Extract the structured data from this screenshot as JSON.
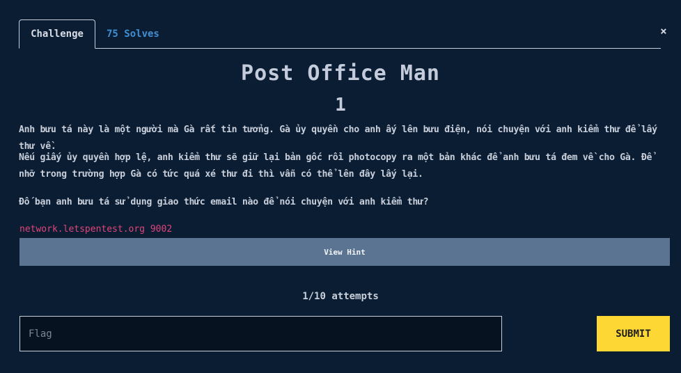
{
  "tabs": {
    "challenge_label": "Challenge",
    "solves_label": "75 Solves"
  },
  "close": {
    "glyph": "×"
  },
  "challenge": {
    "title": "Post Office Man",
    "points": "1",
    "description": [
      "Anh bưu tá này là một người mà Gà rất tin tưởng. Gà ủy quyền cho anh ấy lên bưu điện, nói chuyện với anh kiểm thư để lấy thư về.",
      "Nếu giấy ủy quyền hợp lệ, anh kiểm thư sẽ giữ lại bản gốc rồi photocopy ra một bản khác để anh bưu tá đem về cho Gà. Để nhỡ trong trường hợp Gà có tức quá xé thư đi thì vẫn có thể lên đây lấy lại.",
      "Đố bạn anh bưu tá sử dụng giao thức email nào để nói chuyện với anh kiểm thư?"
    ],
    "connection_info": "network.letspentest.org 9002"
  },
  "hint": {
    "label": "View Hint"
  },
  "attempts": {
    "text": "1/10 attempts"
  },
  "flag": {
    "placeholder": "Flag",
    "value": ""
  },
  "submit": {
    "label": "SUBMIT"
  },
  "colors": {
    "background": "#0b1d33",
    "accent_link": "#3f8fd1",
    "connection": "#e0457b",
    "hint_button": "#5b7491",
    "submit_button": "#fdd835"
  }
}
